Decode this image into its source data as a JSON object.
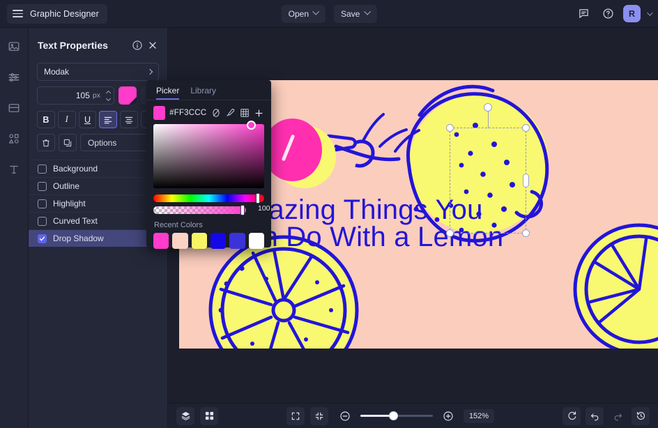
{
  "topbar": {
    "brand": "Graphic Designer",
    "menu_icon": "hamburger-icon",
    "open_label": "Open",
    "save_label": "Save",
    "comment_icon": "comment-icon",
    "help_icon": "help-circle-icon",
    "avatar_initial": "R"
  },
  "rail": {
    "items": [
      {
        "icon": "image-icon",
        "name": "image"
      },
      {
        "icon": "adjustments-icon",
        "name": "adjust"
      },
      {
        "icon": "layout-icon",
        "name": "layout"
      },
      {
        "icon": "shapes-icon",
        "name": "shapes"
      },
      {
        "icon": "text-icon",
        "name": "text"
      }
    ]
  },
  "panel": {
    "title": "Text Properties",
    "info_icon": "info-circle-icon",
    "close_icon": "close-icon",
    "font_family": "Modak",
    "font_size": "105",
    "font_size_unit": "px",
    "text_color": "#FF3CCC",
    "bold_label": "B",
    "italic_label": "I",
    "underline_label": "U",
    "align_left": "align-left-icon",
    "align_center": "align-center-icon",
    "align_right": "align-right-icon",
    "delete_icon": "trash-icon",
    "duplicate_icon": "copy-icon",
    "options_label": "Options",
    "checkboxes": [
      {
        "label": "Background",
        "checked": false
      },
      {
        "label": "Outline",
        "checked": false
      },
      {
        "label": "Highlight",
        "checked": false
      },
      {
        "label": "Curved Text",
        "checked": false
      },
      {
        "label": "Drop Shadow",
        "checked": true
      }
    ]
  },
  "picker": {
    "tab_picker": "Picker",
    "tab_library": "Library",
    "hex": "#FF3CCC",
    "swatch_color": "#FF3CCC",
    "no_color_icon": "no-color-icon",
    "eyedropper_icon": "eyedropper-icon",
    "grid_icon": "grid-icon",
    "add_icon": "plus-icon",
    "alpha_value": "100",
    "recent_label": "Recent Colors",
    "recent_colors": [
      "#FF3CCC",
      "#FBD3C5",
      "#F7F566",
      "#1507E8",
      "#3B33D8",
      "#FFFFFF"
    ]
  },
  "canvas": {
    "background_color": "#FBCDBD",
    "text": "Amazing Things You Can Do With a Lemon",
    "text_color": "#2215D8",
    "lemon_yellow": "#F9F871",
    "lemon_outline": "#2215D8"
  },
  "bottombar": {
    "layers_icon": "layers-icon",
    "grid_icon": "grid-view-icon",
    "fullscreen_icon": "expand-icon",
    "fit_icon": "collapse-icon",
    "zoom_out_icon": "minus-circle-icon",
    "zoom_in_icon": "plus-circle-icon",
    "zoom_value": "152%",
    "refresh_icon": "refresh-icon",
    "undo_icon": "undo-icon",
    "redo_icon": "redo-icon",
    "history_icon": "history-icon"
  }
}
